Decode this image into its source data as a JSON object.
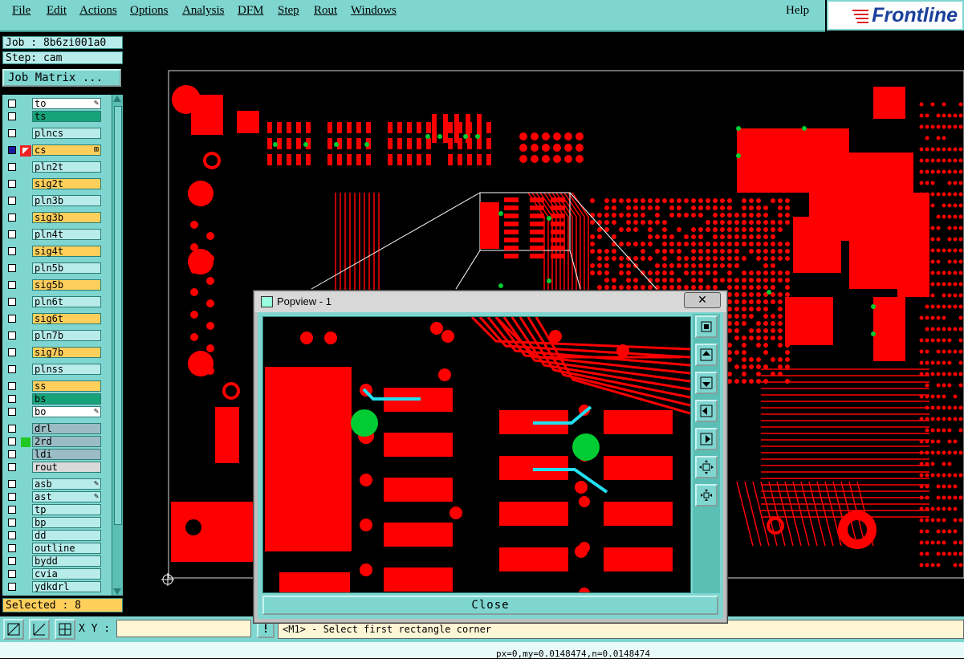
{
  "menubar": {
    "items": [
      {
        "label": "File"
      },
      {
        "label": "Edit"
      },
      {
        "label": "Actions"
      },
      {
        "label": "Options"
      },
      {
        "label": "Analysis"
      },
      {
        "label": "DFM"
      },
      {
        "label": "Step"
      },
      {
        "label": "Rout"
      },
      {
        "label": "Windows"
      }
    ],
    "help": "Help",
    "logo_text": "Frontline"
  },
  "left_panel": {
    "job": "Job : 8b6zi001a0",
    "step": "Step: cam",
    "job_matrix_button": "Job Matrix ...",
    "layers": [
      {
        "name": "to",
        "style": "white"
      },
      {
        "name": "ts",
        "style": "sm"
      },
      {
        "name": "plncs",
        "style": "cu"
      },
      {
        "name": "cs",
        "style": "orange",
        "active": true
      },
      {
        "name": "pln2t",
        "style": "cu"
      },
      {
        "name": "sig2t",
        "style": "orange"
      },
      {
        "name": "pln3b",
        "style": "cu"
      },
      {
        "name": "sig3b",
        "style": "orange"
      },
      {
        "name": "pln4t",
        "style": "cu"
      },
      {
        "name": "sig4t",
        "style": "orange"
      },
      {
        "name": "pln5b",
        "style": "cu"
      },
      {
        "name": "sig5b",
        "style": "orange"
      },
      {
        "name": "pln6t",
        "style": "cu"
      },
      {
        "name": "sig6t",
        "style": "orange"
      },
      {
        "name": "pln7b",
        "style": "cu"
      },
      {
        "name": "sig7b",
        "style": "orange"
      },
      {
        "name": "plnss",
        "style": "cu"
      },
      {
        "name": "ss",
        "style": "orange"
      },
      {
        "name": "bs",
        "style": "sm"
      },
      {
        "name": "bo",
        "style": "white"
      },
      {
        "name": "drl",
        "style": "drill"
      },
      {
        "name": "2rd",
        "style": "drill"
      },
      {
        "name": "ldi",
        "style": "drill"
      },
      {
        "name": "rout",
        "style": "grey"
      },
      {
        "name": "asb",
        "style": "cu"
      },
      {
        "name": "ast",
        "style": "cu"
      },
      {
        "name": "tp",
        "style": "cu"
      },
      {
        "name": "bp",
        "style": "cu"
      },
      {
        "name": "dd",
        "style": "cu"
      },
      {
        "name": "outline",
        "style": "cu"
      },
      {
        "name": "bydd",
        "style": "cu"
      },
      {
        "name": "cvia",
        "style": "cu"
      },
      {
        "name": "ydkdrl",
        "style": "cu"
      }
    ],
    "selected": "Selected : 8"
  },
  "bottom_bar": {
    "xy_label": "X Y :",
    "xy_value": "",
    "message": "<M1> - Select first rectangle corner",
    "excl": "!"
  },
  "status_bar": {
    "text": "px=0,my=0.0148474,n=0.0148474"
  },
  "popview": {
    "title": "Popview - 1",
    "close_x": "✕",
    "close_button": "Close",
    "tool_icons": [
      "zoom-fit-icon",
      "pan-up-icon",
      "pan-down-icon",
      "pan-left-icon",
      "pan-right-icon",
      "zoom-in-icon",
      "zoom-out-icon"
    ]
  },
  "colors": {
    "panel": "#7fd6d0",
    "copper": "#ff0000",
    "via_green": "#00cc33",
    "trace_cyan": "#22e0f0",
    "highlight_orange": "#ffcf5c"
  }
}
